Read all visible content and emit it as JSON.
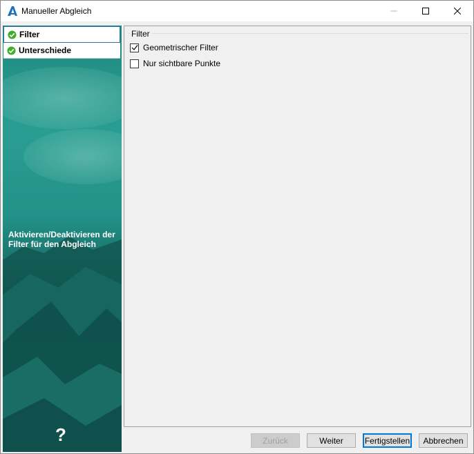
{
  "window": {
    "title": "Manueller Abgleich"
  },
  "titlebar_icons": {
    "app": "autodesk-app-icon",
    "minimize": "minimize-icon",
    "maximize": "maximize-icon",
    "close": "close-icon"
  },
  "sidebar": {
    "items": [
      {
        "label": "Filter",
        "icon": "check-circle-icon",
        "active": true
      },
      {
        "label": "Unterschiede",
        "icon": "check-circle-icon",
        "active": false
      }
    ],
    "description": "Aktivieren/Deaktivieren der Filter für den Abgleich",
    "help_glyph": "?"
  },
  "main": {
    "group_label": "Filter",
    "checkboxes": [
      {
        "label": "Geometrischer Filter",
        "checked": true
      },
      {
        "label": "Nur sichtbare Punkte",
        "checked": false
      }
    ]
  },
  "buttons": {
    "back": "Zurück",
    "next": "Weiter",
    "finish": "Fertigstellen",
    "cancel": "Abbrechen"
  },
  "colors": {
    "accent": "#0078d7",
    "check_green": "#3fae2a",
    "panel_teal": "#1f8a80"
  }
}
